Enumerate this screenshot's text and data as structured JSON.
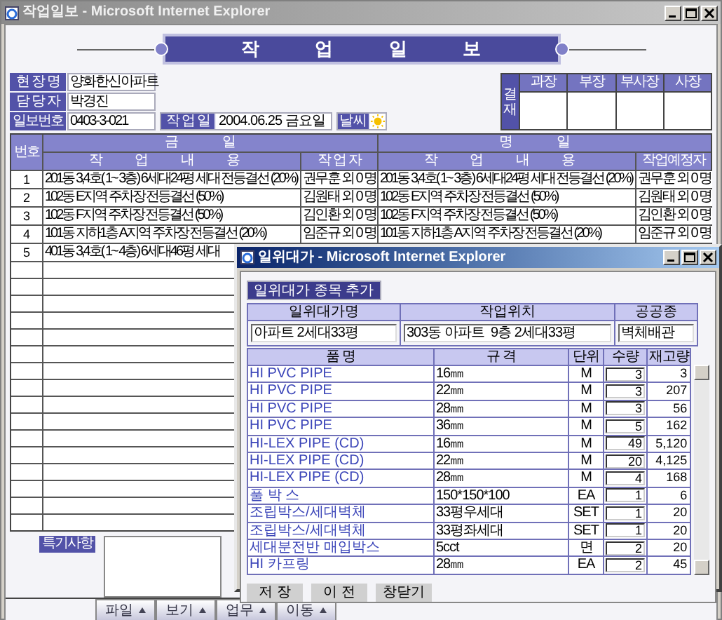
{
  "window": {
    "title": "작업일보 - Microsoft Internet Explorer"
  },
  "banner": {
    "title": "작 업 일 보"
  },
  "info": {
    "fields": [
      {
        "label": "현 장 명",
        "value": "양화한신아파트"
      },
      {
        "label": "담 당 자",
        "value": "박경진"
      },
      {
        "label": "일보번호",
        "value": "0403-3-021"
      }
    ],
    "work_date": {
      "label": "작 업 일",
      "value": "2004.06.25 금요일"
    },
    "weather": {
      "label": "날씨",
      "kind": "sunny"
    }
  },
  "approval": {
    "label": "결재",
    "columns": [
      "과장",
      "부장",
      "부사장",
      "사장"
    ]
  },
  "work_table": {
    "number_header": "번호",
    "today_header": "금 일",
    "tomorrow_header": "명 일",
    "columns": [
      "작 업 내 용",
      "작 업 자",
      "작 업 내 용",
      "작업예정자"
    ],
    "rows": [
      {
        "number": "1",
        "cells": [
          "201동 3,4호( 1~ 3층) 6세대24평 세대 전등결선 (20%)",
          "권무훈 외 0 명",
          "201동 3,4호( 1~ 3층) 6세대24평 세대 전등결선 (20%)",
          "권무훈 외 0 명"
        ]
      },
      {
        "number": "2",
        "cells": [
          "102동 E지역 주차장 전등결선 (50%)",
          "김원태 외 0 명",
          "102동 E지역 주차장 전등결선 (50%)",
          "김원태 외 0 명"
        ]
      },
      {
        "number": "3",
        "cells": [
          "102동 F지역 주차장 전등결선 (50%)",
          "김인환 외 0 명",
          "102동 F지역 주차장 전등결선 (50%)",
          "김인환 외 0 명"
        ]
      },
      {
        "number": "4",
        "cells": [
          "101동 지하1층 A지역 주차장 전등결선 (20%)",
          "임준규 외 0 명",
          "101동 지하1층 A지역 주차장 전등결선 (20%)",
          "임준규 외 0 명"
        ]
      },
      {
        "number": "5",
        "cells": [
          "401동 3,4호( 1~ 4층) 6세대46평 세대"
        ]
      }
    ]
  },
  "special_remarks": {
    "label": "특기사항"
  },
  "bottom_menu": [
    "파일",
    "보기",
    "업무",
    "이동"
  ],
  "popup": {
    "title": "일위대가 - Microsoft Internet Explorer",
    "add_button": "일위대가 종목 추가",
    "header_fields": [
      {
        "label": "일위대가명",
        "value": "아파트 2세대33평"
      },
      {
        "label": "작업위치",
        "value": "303동 아파트  9층 2세대33평"
      },
      {
        "label": "공공종",
        "value": "벽체배관"
      }
    ],
    "columns": [
      "품 명",
      "규 격",
      "단위",
      "수량",
      "재고량"
    ],
    "rows": [
      {
        "name": "HI PVC PIPE",
        "spec": "16㎜",
        "unit": "M",
        "quantity": "3",
        "stock": "3"
      },
      {
        "name": "HI PVC PIPE",
        "spec": "22㎜",
        "unit": "M",
        "quantity": "3",
        "stock": "207"
      },
      {
        "name": "HI PVC PIPE",
        "spec": "28㎜",
        "unit": "M",
        "quantity": "3",
        "stock": "56"
      },
      {
        "name": "HI PVC PIPE",
        "spec": "36㎜",
        "unit": "M",
        "quantity": "5",
        "stock": "162"
      },
      {
        "name": "HI-LEX PIPE (CD)",
        "spec": "16㎜",
        "unit": "M",
        "quantity": "49",
        "stock": "5,120"
      },
      {
        "name": "HI-LEX PIPE (CD)",
        "spec": "22㎜",
        "unit": "M",
        "quantity": "20",
        "stock": "4,125"
      },
      {
        "name": "HI-LEX PIPE (CD)",
        "spec": "28㎜",
        "unit": "M",
        "quantity": "4",
        "stock": "168"
      },
      {
        "name": "풀 박 스",
        "spec": "150*150*100",
        "unit": "EA",
        "quantity": "1",
        "stock": "6"
      },
      {
        "name": "조립박스/세대벽체",
        "spec": "33평우세대",
        "unit": "SET",
        "quantity": "1",
        "stock": "20"
      },
      {
        "name": "조립박스/세대벽체",
        "spec": "33평좌세대",
        "unit": "SET",
        "quantity": "1",
        "stock": "20"
      },
      {
        "name": "세대분전반 매입박스",
        "spec": "5cct",
        "unit": "면",
        "quantity": "2",
        "stock": "20"
      },
      {
        "name": "HI 카프링",
        "spec": "28㎜",
        "unit": "EA",
        "quantity": "2",
        "stock": "45"
      }
    ],
    "buttons": [
      "저 장",
      "이 전",
      "창닫기"
    ]
  }
}
